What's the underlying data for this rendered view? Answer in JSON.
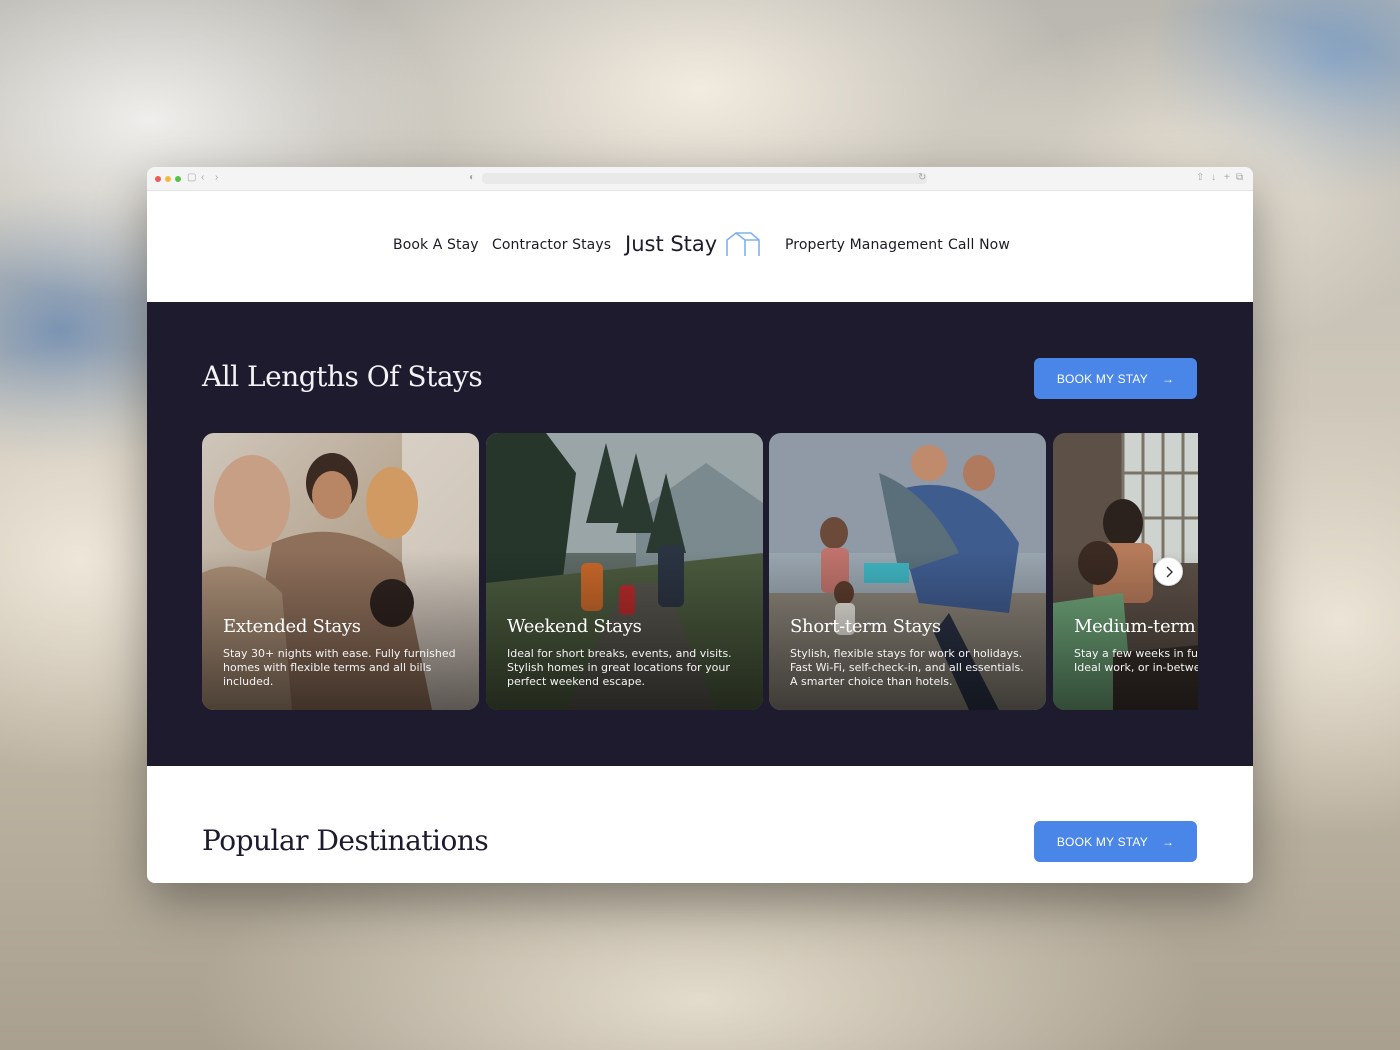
{
  "nav": {
    "links_left": [
      "Book A Stay",
      "Contractor Stays"
    ],
    "logo_text": "Just Stay",
    "links_right": [
      "Property Management",
      "Call Now"
    ]
  },
  "stays_section": {
    "title": "All Lengths Of Stays",
    "cta_label": "BOOK MY STAY",
    "cards": [
      {
        "title": "Extended Stays",
        "description": "Stay 30+ nights with ease. Fully furnished homes with flexible terms and all bills included.",
        "image": "family-home-photo"
      },
      {
        "title": "Weekend Stays",
        "description": "Ideal for short breaks, events, and visits. Stylish homes in great locations for your perfect weekend escape.",
        "image": "forest-walk-photo"
      },
      {
        "title": "Short-term Stays",
        "description": "Stylish, flexible stays for work or holidays. Fast Wi-Fi, self-check-in, and all essentials. A smarter choice than hotels.",
        "image": "beach-family-photo"
      },
      {
        "title": "Medium-term S",
        "description": "Stay a few weeks in fully with bills included. Ideal work, or in-between mov",
        "image": "couple-laptop-photo"
      }
    ]
  },
  "destinations_section": {
    "title": "Popular Destinations",
    "cta_label": "BOOK MY STAY"
  },
  "colors": {
    "accent": "#4a86e8",
    "dark_bg": "#1d1b2d"
  }
}
